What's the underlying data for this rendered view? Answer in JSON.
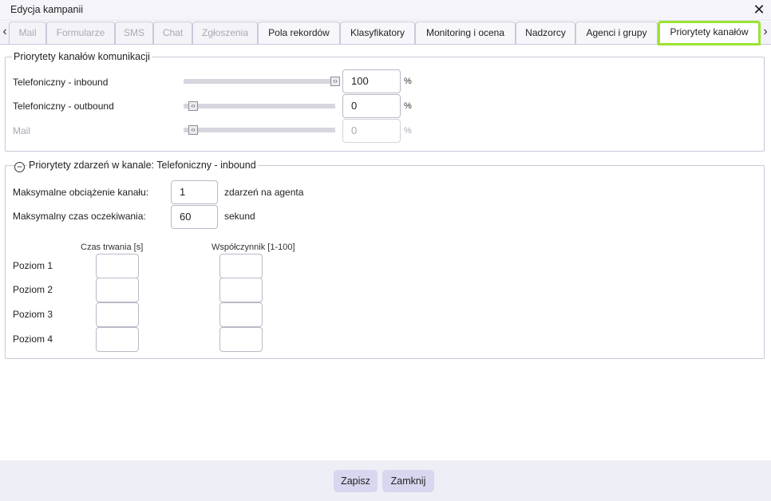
{
  "window": {
    "title": "Edycja kampanii"
  },
  "tabs": [
    {
      "label": "Mail",
      "state": "disabled"
    },
    {
      "label": "Formularze",
      "state": "disabled"
    },
    {
      "label": "SMS",
      "state": "disabled"
    },
    {
      "label": "Chat",
      "state": "disabled"
    },
    {
      "label": "Zgłoszenia",
      "state": "disabled"
    },
    {
      "label": "Pola rekordów",
      "state": "normal"
    },
    {
      "label": "Klasyfikatory",
      "state": "normal"
    },
    {
      "label": "Monitoring i ocena",
      "state": "normal"
    },
    {
      "label": "Nadzorcy",
      "state": "normal"
    },
    {
      "label": "Agenci i grupy",
      "state": "normal"
    },
    {
      "label": "Priorytety kanałów",
      "state": "active"
    }
  ],
  "channels": {
    "legend": "Priorytety kanałów komunikacji",
    "unit": "%",
    "rows": [
      {
        "label": "Telefoniczny - inbound",
        "value": "100",
        "level": 1.0,
        "enabled": true
      },
      {
        "label": "Telefoniczny - outbound",
        "value": "0",
        "level": 0.0,
        "enabled": true
      },
      {
        "label": "Mail",
        "value": "0",
        "level": 0.0,
        "enabled": false
      }
    ]
  },
  "events": {
    "legend": "Priorytety zdarzeń w kanale: Telefoniczny - inbound",
    "max_load": {
      "label": "Maksymalne obciążenie kanału:",
      "value": "1",
      "unit": "zdarzeń na agenta"
    },
    "max_wait": {
      "label": "Maksymalny czas oczekiwania:",
      "value": "60",
      "unit": "sekund"
    },
    "col_duration": "Czas trwania [s]",
    "col_factor": "Współczynnik [1-100]",
    "levels": [
      {
        "label": "Poziom 1",
        "duration": "",
        "factor": ""
      },
      {
        "label": "Poziom 2",
        "duration": "",
        "factor": ""
      },
      {
        "label": "Poziom 3",
        "duration": "",
        "factor": ""
      },
      {
        "label": "Poziom 4",
        "duration": "",
        "factor": ""
      }
    ]
  },
  "footer": {
    "save_label": "Zapisz",
    "close_label": "Zamknij"
  },
  "colors": {
    "active_tab_border": "#9be431",
    "button_bg": "#d7d7f0"
  }
}
